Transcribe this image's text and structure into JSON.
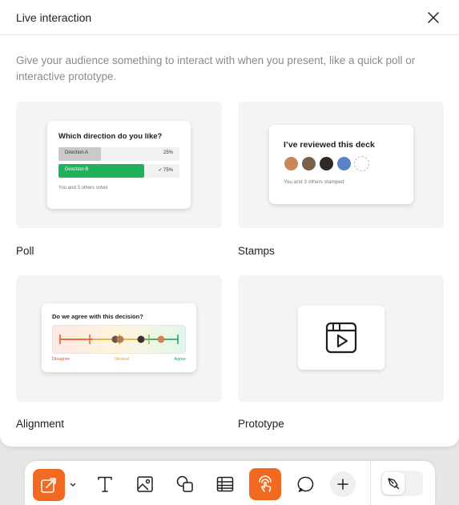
{
  "dialog": {
    "title": "Live interaction",
    "description": "Give your audience something to interact with when you present, like a quick poll or interactive prototype."
  },
  "cards": [
    {
      "label": "Poll"
    },
    {
      "label": "Stamps"
    },
    {
      "label": "Alignment"
    },
    {
      "label": "Prototype"
    }
  ],
  "poll": {
    "question": "Which direction do you like?",
    "options": [
      {
        "label": "Direction A",
        "percent": "25%",
        "fill": 0.35,
        "color": "#c9c9c9"
      },
      {
        "label": "Direction B",
        "percent": "✓ 75%",
        "fill": 0.71,
        "color": "#1eb35a"
      }
    ],
    "footer": "You and 3 others voted"
  },
  "stamps": {
    "question": "I’ve reviewed this deck",
    "footer": "You and 3 others stamped",
    "avatar_colors": [
      "#c9875a",
      "#7a6048",
      "#2e2a26",
      "#5a82c8"
    ]
  },
  "alignment": {
    "question": "Do we agree with this decision?",
    "left_label": "Disagree",
    "mid_label": "Neutral",
    "right_label": "Agree",
    "colors": {
      "disagree": "#e8502f",
      "neutral": "#e6a21e",
      "agree": "#1aa76a"
    }
  },
  "toolbar": {
    "accent": "#f26a21",
    "tools": [
      {
        "name": "live-interaction-icon",
        "active": true
      },
      {
        "name": "text-icon"
      },
      {
        "name": "image-icon"
      },
      {
        "name": "shapes-icon"
      },
      {
        "name": "table-icon"
      },
      {
        "name": "interactive-touch-icon",
        "active": true
      },
      {
        "name": "comment-icon"
      },
      {
        "name": "add-icon"
      },
      {
        "name": "pen-tool-icon"
      }
    ]
  }
}
